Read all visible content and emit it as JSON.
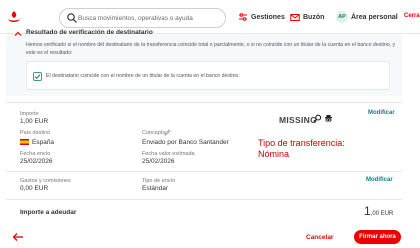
{
  "header": {
    "logo_icon": "santander-flame-icon",
    "search": {
      "placeholder": "Busca movimientos, operativas o ayuda",
      "icon": "search-icon"
    },
    "nav": [
      {
        "label": "Gestiones",
        "icon": "sliders-icon"
      },
      {
        "label": "Buzón",
        "icon": "mail-icon"
      },
      {
        "label": "Área personal",
        "avatar": "AP"
      }
    ],
    "cut_link": "Cerra"
  },
  "verification": {
    "title": "Resultado de verificación de destinatario",
    "description": "Hemos verificado si el nombre del destinatario de la transferencia coincide total o parcialmente, o si no coincide con un titular de la cuenta en el banco destino, y este es el resultado:",
    "result": "El destinatario coincide con el nombre de un titular de la cuenta en el banco destino.",
    "checked": true
  },
  "details": {
    "importe": {
      "label": "Importe",
      "value": "1,00 EUR"
    },
    "pais_destino": {
      "label": "País destino",
      "value": "España"
    },
    "concepto": {
      "label": "Concepto",
      "value": "Enviado por Banco Santander"
    },
    "fecha_envio": {
      "label": "Fecha envío",
      "value": "25/02/2026"
    },
    "fecha_valor": {
      "label": "Fecha valor estimada",
      "value": "25/02/2026"
    },
    "gastos": {
      "label": "Gastos y comisiones",
      "value": "0,00 EUR"
    },
    "tipo_envio": {
      "label": "Tipo de envío",
      "value": "Estándar"
    },
    "modificar_label": "Modificar"
  },
  "annotations": {
    "missing": "MISSING",
    "transfer_type": "Tipo de transferencia: Nómina"
  },
  "total": {
    "label": "Importe a adeudar",
    "integer": "1",
    "rest": ",00 EUR"
  },
  "footer": {
    "cancel_label": "Cancelar",
    "sign_label": "Firmar ahora"
  },
  "colors": {
    "brand_red": "#ec0000",
    "link_teal": "#137e84",
    "annotation_red": "#cc0000"
  }
}
